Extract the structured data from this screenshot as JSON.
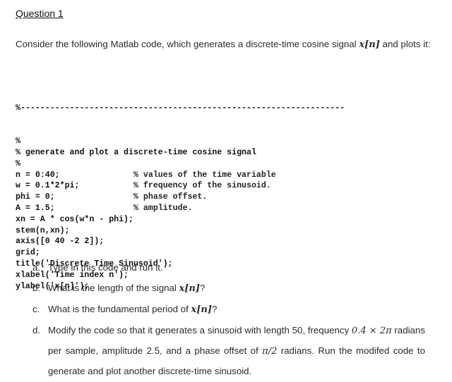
{
  "heading": "Question 1",
  "intro": {
    "text_before": "Consider the following Matlab code, which generates a discrete-time cosine signal ",
    "math_signal": "x[n]",
    "text_after": " and plots it:"
  },
  "code": {
    "divider": "%------------------------------------------------------------------",
    "lines": [
      {
        "code": "%",
        "comment": ""
      },
      {
        "code": "% generate and plot a discrete-time cosine signal",
        "comment": ""
      },
      {
        "code": "%",
        "comment": ""
      },
      {
        "code": "n = 0:40;",
        "comment": "% values of the time variable"
      },
      {
        "code": "w = 0.1*2*pi;",
        "comment": "% frequency of the sinusoid."
      },
      {
        "code": "phi = 0;",
        "comment": "% phase offset."
      },
      {
        "code": "A = 1.5;",
        "comment": "% amplitude."
      },
      {
        "code": "xn = A * cos(w*n - phi);",
        "comment": ""
      },
      {
        "code": "stem(n,xn);",
        "comment": ""
      },
      {
        "code": "axis([0 40 -2 2]);",
        "comment": ""
      },
      {
        "code": "grid;",
        "comment": ""
      },
      {
        "code": "title('Discrete Time Sinusoid');",
        "comment": ""
      },
      {
        "code": "xlabel('Time index n');",
        "comment": ""
      },
      {
        "code": "ylabel('x[n]');",
        "comment": ""
      }
    ]
  },
  "questions": [
    {
      "label": "a.",
      "text": "Type in this code and run it."
    },
    {
      "label": "b.",
      "text_before": "What is the length of the signal ",
      "math": "x[n]",
      "text_after": "?"
    },
    {
      "label": "c.",
      "text_before": "What is the fundamental period of ",
      "math": "x[n]",
      "text_after": "?"
    },
    {
      "label": "d.",
      "text_1": "Modify the code so that it generates a sinusoid with length 50, frequency ",
      "math_1": "0.4 × 2π",
      "text_2": " radians per sample, amplitude 2.5, and a phase offset of ",
      "math_2": "π/2",
      "text_3": " radians. Run the modifed code to generate and plot another discrete-time sinusoid."
    }
  ]
}
